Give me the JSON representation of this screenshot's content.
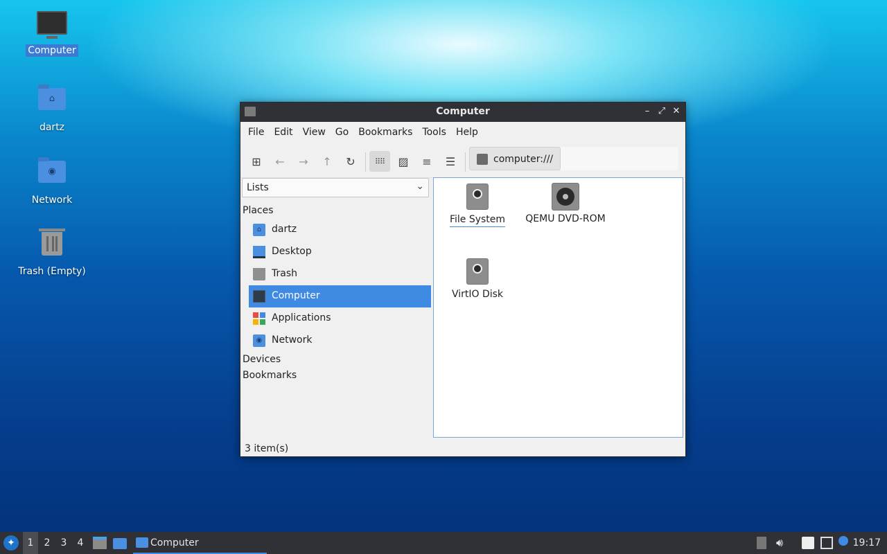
{
  "desktop": {
    "icons": [
      {
        "label": "Computer"
      },
      {
        "label": "dartz"
      },
      {
        "label": "Network"
      },
      {
        "label": "Trash (Empty)"
      }
    ]
  },
  "window": {
    "title": "Computer",
    "controls": {
      "minimize": "–",
      "maximize": "⤢",
      "close": "✕"
    },
    "menu": [
      "File",
      "Edit",
      "View",
      "Go",
      "Bookmarks",
      "Tools",
      "Help"
    ],
    "location": "computer:///",
    "sidebar": {
      "mode": "Lists",
      "sections": {
        "places": "Places",
        "devices": "Devices",
        "bookmarks": "Bookmarks"
      },
      "places": [
        {
          "label": "dartz",
          "icon": "home-folder-icon"
        },
        {
          "label": "Desktop",
          "icon": "desktop-icon"
        },
        {
          "label": "Trash",
          "icon": "trash-icon"
        },
        {
          "label": "Computer",
          "icon": "computer-icon",
          "selected": true
        },
        {
          "label": "Applications",
          "icon": "applications-icon"
        },
        {
          "label": "Network",
          "icon": "network-folder-icon"
        }
      ]
    },
    "items": [
      {
        "label": "File System",
        "icon": "hard-disk-icon"
      },
      {
        "label": "QEMU DVD-ROM",
        "icon": "optical-drive-icon"
      },
      {
        "label": "VirtIO Disk",
        "icon": "hard-disk-icon"
      }
    ],
    "status": "3 item(s)"
  },
  "taskbar": {
    "workspaces": [
      "1",
      "2",
      "3",
      "4"
    ],
    "active_workspace": "1",
    "task": "Computer",
    "clock": "19:17"
  },
  "colors": {
    "accent": "#3f8ae3",
    "titlebar": "#2f3136",
    "folder": "#4a8fe0"
  }
}
